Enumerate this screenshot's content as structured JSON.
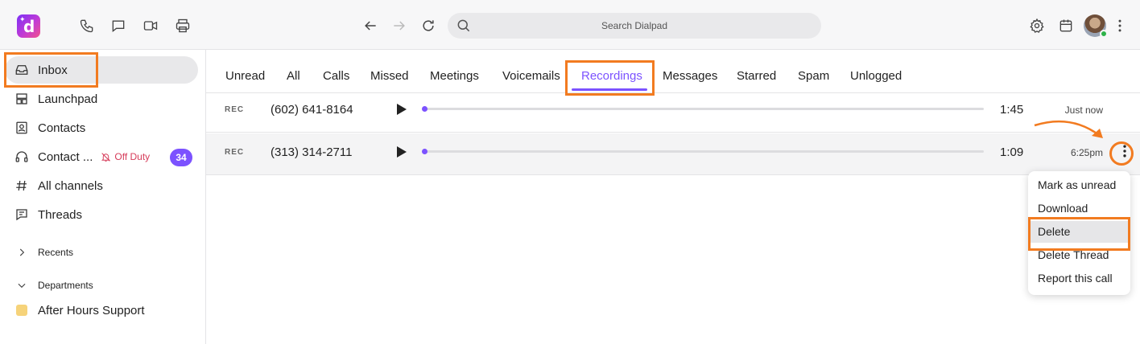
{
  "topbar": {
    "search_placeholder": "Search Dialpad"
  },
  "sidebar": {
    "items": [
      {
        "label": "Inbox"
      },
      {
        "label": "Launchpad"
      },
      {
        "label": "Contacts"
      },
      {
        "label": "Contact ...",
        "status": "Off Duty",
        "badge": "34"
      },
      {
        "label": "All channels"
      },
      {
        "label": "Threads"
      }
    ],
    "recents_label": "Recents",
    "departments_label": "Departments",
    "departments": [
      {
        "label": "After Hours Support"
      }
    ]
  },
  "tabs": [
    {
      "label": "Unread"
    },
    {
      "label": "All"
    },
    {
      "label": "Calls"
    },
    {
      "label": "Missed"
    },
    {
      "label": "Meetings"
    },
    {
      "label": "Voicemails"
    },
    {
      "label": "Recordings",
      "active": true
    },
    {
      "label": "Messages"
    },
    {
      "label": "Starred"
    },
    {
      "label": "Spam"
    },
    {
      "label": "Unlogged"
    }
  ],
  "recordings": [
    {
      "tag": "REC",
      "number": "(602) 641-8164",
      "duration": "1:45",
      "time": "Just now"
    },
    {
      "tag": "REC",
      "number": "(313) 314-2711",
      "duration": "1:09",
      "time": "6:25pm"
    }
  ],
  "menu": {
    "items": [
      {
        "label": "Mark as unread"
      },
      {
        "label": "Download"
      },
      {
        "label": "Delete",
        "highlighted": true
      },
      {
        "label": "Delete Thread"
      },
      {
        "label": "Report this call"
      }
    ]
  },
  "colors": {
    "accent": "#7c52ff",
    "callout": "#f27b20",
    "off_duty": "#d63c5a"
  }
}
